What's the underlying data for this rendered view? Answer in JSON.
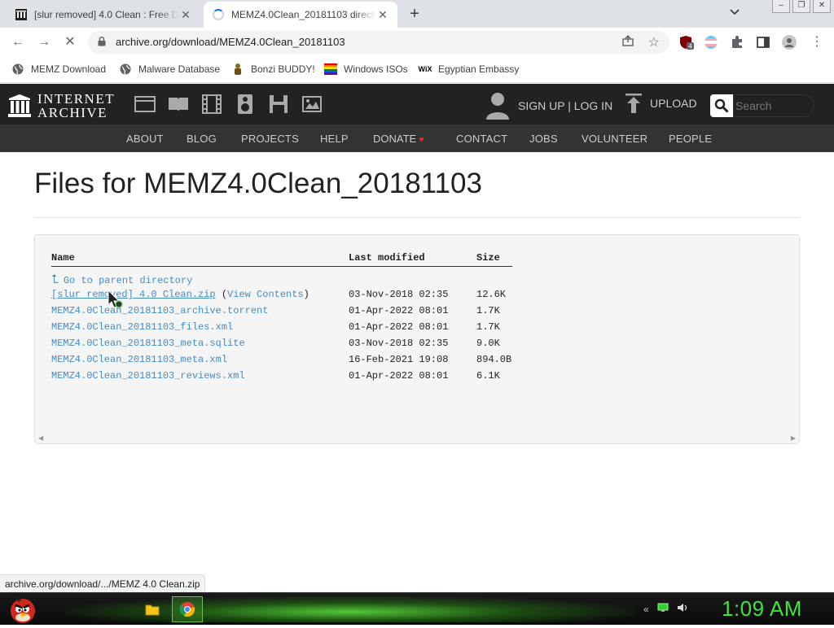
{
  "browser": {
    "tabs": [
      {
        "title": "[slur removed] 4.0 Clean : Free D",
        "active": false
      },
      {
        "title": "MEMZ4.0Clean_20181103 directo",
        "active": true
      }
    ],
    "new_tab": "+",
    "address": "archive.org/download/MEMZ4.0Clean_20181103",
    "status_url": "archive.org/download/.../MEMZ 4.0 Clean.zip",
    "extension_badge": "4"
  },
  "bookmarks": [
    {
      "label": "MEMZ Download",
      "icon": "globe-icon"
    },
    {
      "label": "Malware Database",
      "icon": "globe-icon"
    },
    {
      "label": "Bonzi BUDDY!",
      "icon": "bonzi-icon"
    },
    {
      "label": "Windows ISOs",
      "icon": "rainbow-flag-icon"
    },
    {
      "label": "Egyptian Embassy",
      "icon": "wix-icon",
      "icon_text": "WiX"
    }
  ],
  "ia": {
    "logo_line1": "INTERNET",
    "logo_line2": "ARCHIVE",
    "account": "SIGN UP | LOG IN",
    "upload": "UPLOAD",
    "search_placeholder": "Search",
    "nav": [
      "ABOUT",
      "BLOG",
      "PROJECTS",
      "HELP",
      "DONATE",
      "CONTACT",
      "JOBS",
      "VOLUNTEER",
      "PEOPLE"
    ]
  },
  "page": {
    "title": "Files for MEMZ4.0Clean_20181103",
    "columns": {
      "name": "Name",
      "modified": "Last modified",
      "size": "Size"
    },
    "parent_link": "Go to parent directory",
    "files": [
      {
        "name": "[slur removed] 4.0 Clean.zip",
        "extra": "View Contents",
        "modified": "03-Nov-2018 02:35",
        "size": "12.6K"
      },
      {
        "name": "MEMZ4.0Clean_20181103_archive.torrent",
        "modified": "01-Apr-2022 08:01",
        "size": "1.7K"
      },
      {
        "name": "MEMZ4.0Clean_20181103_files.xml",
        "modified": "01-Apr-2022 08:01",
        "size": "1.7K"
      },
      {
        "name": "MEMZ4.0Clean_20181103_meta.sqlite",
        "modified": "03-Nov-2018 02:35",
        "size": "9.0K"
      },
      {
        "name": "MEMZ4.0Clean_20181103_meta.xml",
        "modified": "16-Feb-2021 19:08",
        "size": "894.0B"
      },
      {
        "name": "MEMZ4.0Clean_20181103_reviews.xml",
        "modified": "01-Apr-2022 08:01",
        "size": "6.1K"
      }
    ]
  },
  "taskbar": {
    "clock": "1:09 AM"
  },
  "colors": {
    "link": "#428bca",
    "ia_dark": "#222222",
    "ia_nav": "#333333",
    "clock_green": "#3fe23f"
  }
}
